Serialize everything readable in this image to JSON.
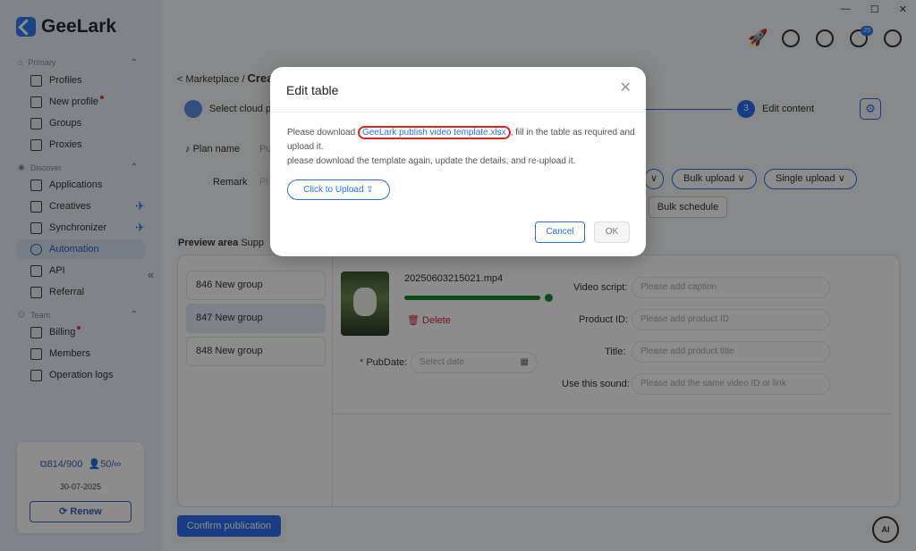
{
  "app": {
    "name": "GeeLark"
  },
  "window_controls": {
    "minimize": "—",
    "maximize": "☐",
    "close": "✕"
  },
  "sidebar": {
    "primary_label": "Primary",
    "primary_items": [
      {
        "label": "Profiles"
      },
      {
        "label": "New profile"
      },
      {
        "label": "Groups"
      },
      {
        "label": "Proxies"
      }
    ],
    "discover_label": "Discover",
    "discover_items": [
      {
        "label": "Applications"
      },
      {
        "label": "Creatives"
      },
      {
        "label": "Synchronizer"
      },
      {
        "label": "Automation"
      },
      {
        "label": "API"
      },
      {
        "label": "Referral"
      }
    ],
    "team_label": "Team",
    "team_items": [
      {
        "label": "Billing"
      },
      {
        "label": "Members"
      },
      {
        "label": "Operation logs"
      }
    ],
    "collapse": "«",
    "card": {
      "profiles": "814/900",
      "members": "50/∞",
      "date": "30-07-2025",
      "renew": "Renew"
    }
  },
  "topbar": {
    "notification_count": "25"
  },
  "breadcrumb": {
    "parent": "< Marketplace /",
    "current": "Crea"
  },
  "steps": {
    "step1": "Select cloud ph",
    "step3_num": "3",
    "step3": "Edit content"
  },
  "form": {
    "plan_name_label": "Plan name",
    "plan_value": "Pu",
    "remark_label": "Remark",
    "remark_placeholder": "Pl"
  },
  "buttons": {
    "bulk_upload": "Bulk upload ∨",
    "single_upload": "Single upload ∨",
    "bulk_schedule": "Bulk schedule",
    "confirm": "Confirm publication",
    "ai": "AI"
  },
  "preview": {
    "title": "Preview area",
    "sub": "Supp"
  },
  "groups": [
    {
      "label": "846 New group"
    },
    {
      "label": "847 New group"
    },
    {
      "label": "848 New group"
    }
  ],
  "video": {
    "filename": "20250603215021.mp4",
    "delete": "Delete",
    "pubdate_label": "PubDate:",
    "pubdate_placeholder": "Select date"
  },
  "fields": [
    {
      "label": "Video script:",
      "placeholder": "Please add caption"
    },
    {
      "label": "Product ID:",
      "placeholder": "Please add product ID"
    },
    {
      "label": "Title:",
      "placeholder": "Please add product title"
    },
    {
      "label": "Use this sound:",
      "placeholder": "Please add the same video ID or link"
    }
  ],
  "modal": {
    "title": "Edit table",
    "text_pre": "Please download ",
    "link": "GeeLark publish video template.xlsx",
    "text_post": ", fill in the table as required and upload it.",
    "text2": "please download the template again, update the details, and re-upload it.",
    "upload": "Click to Upload ⇪",
    "cancel": "Cancel",
    "ok": "OK"
  }
}
